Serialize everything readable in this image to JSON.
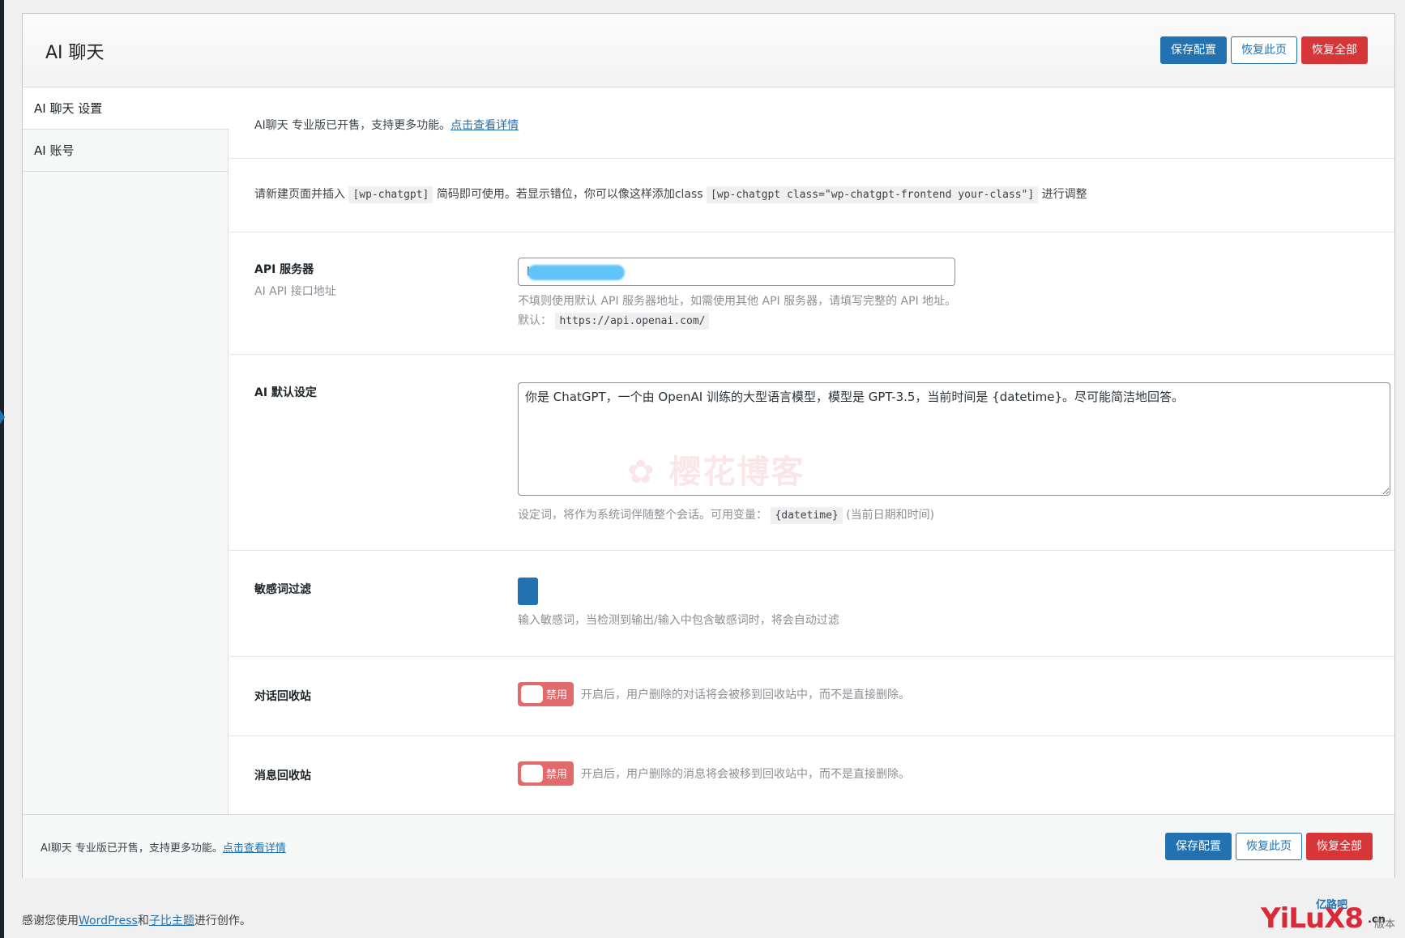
{
  "header": {
    "title": "AI 聊天",
    "save_label": "保存配置",
    "reset_page_label": "恢复此页",
    "reset_all_label": "恢复全部"
  },
  "sidebar": {
    "items": [
      {
        "label": "AI 聊天 设置"
      },
      {
        "label": "AI 账号"
      }
    ]
  },
  "promo": {
    "text": "AI聊天 专业版已开售，支持更多功能。",
    "link": "点击查看详情"
  },
  "shortcode_notice": {
    "prefix": "请新建页面并插入",
    "code1": "[wp-chatgpt]",
    "middle": "简码即可使用。若显示错位，你可以像这样添加class",
    "code2": "[wp-chatgpt class=\"wp-chatgpt-frontend your-class\"]",
    "suffix": "进行调整"
  },
  "api_server": {
    "label": "API 服务器",
    "sublabel": "AI API 接口地址",
    "value": "h",
    "desc": "不填则使用默认 API 服务器地址，如需使用其他 API 服务器，请填写完整的 API 地址。",
    "default_label": "默认：",
    "default_value": "https://api.openai.com/"
  },
  "ai_default": {
    "label": "AI 默认设定",
    "value": "你是 ChatGPT，一个由 OpenAI 训练的大型语言模型，模型是 GPT-3.5，当前时间是 {datetime}。尽可能简洁地回答。",
    "watermark": "樱花博客",
    "desc_prefix": "设定词，将作为系统词伴随整个会话。可用变量：",
    "desc_code": "{datetime}",
    "desc_suffix": "(当前日期和时间)"
  },
  "sensitive_filter": {
    "label": "敏感词过滤",
    "desc": "输入敏感词，当检测到输出/输入中包含敏感词时，将会自动过滤"
  },
  "conversation_recycle": {
    "label": "对话回收站",
    "toggle_label": "禁用",
    "desc": "开启后，用户删除的对话将会被移到回收站中，而不是直接删除。"
  },
  "message_recycle": {
    "label": "消息回收站",
    "toggle_label": "禁用",
    "desc": "开启后，用户删除的消息将会被移到回收站中，而不是直接删除。"
  },
  "footer": {
    "text": "AI聊天 专业版已开售，支持更多功能。",
    "link": "点击查看详情",
    "save_label": "保存配置",
    "reset_page_label": "恢复此页",
    "reset_all_label": "恢复全部"
  },
  "page_footer": {
    "prefix": "感谢您使用",
    "link1": "WordPress",
    "and": "和",
    "link2": "子比主题",
    "suffix": "进行创作。"
  },
  "logo": {
    "text": "YiLuX8",
    "cn": "亿路吧",
    "suffix": ".cn",
    "tail": "版本"
  },
  "colors": {
    "primary": "#2271b1",
    "danger": "#d63638",
    "toggle_off": "#e06a6c"
  }
}
